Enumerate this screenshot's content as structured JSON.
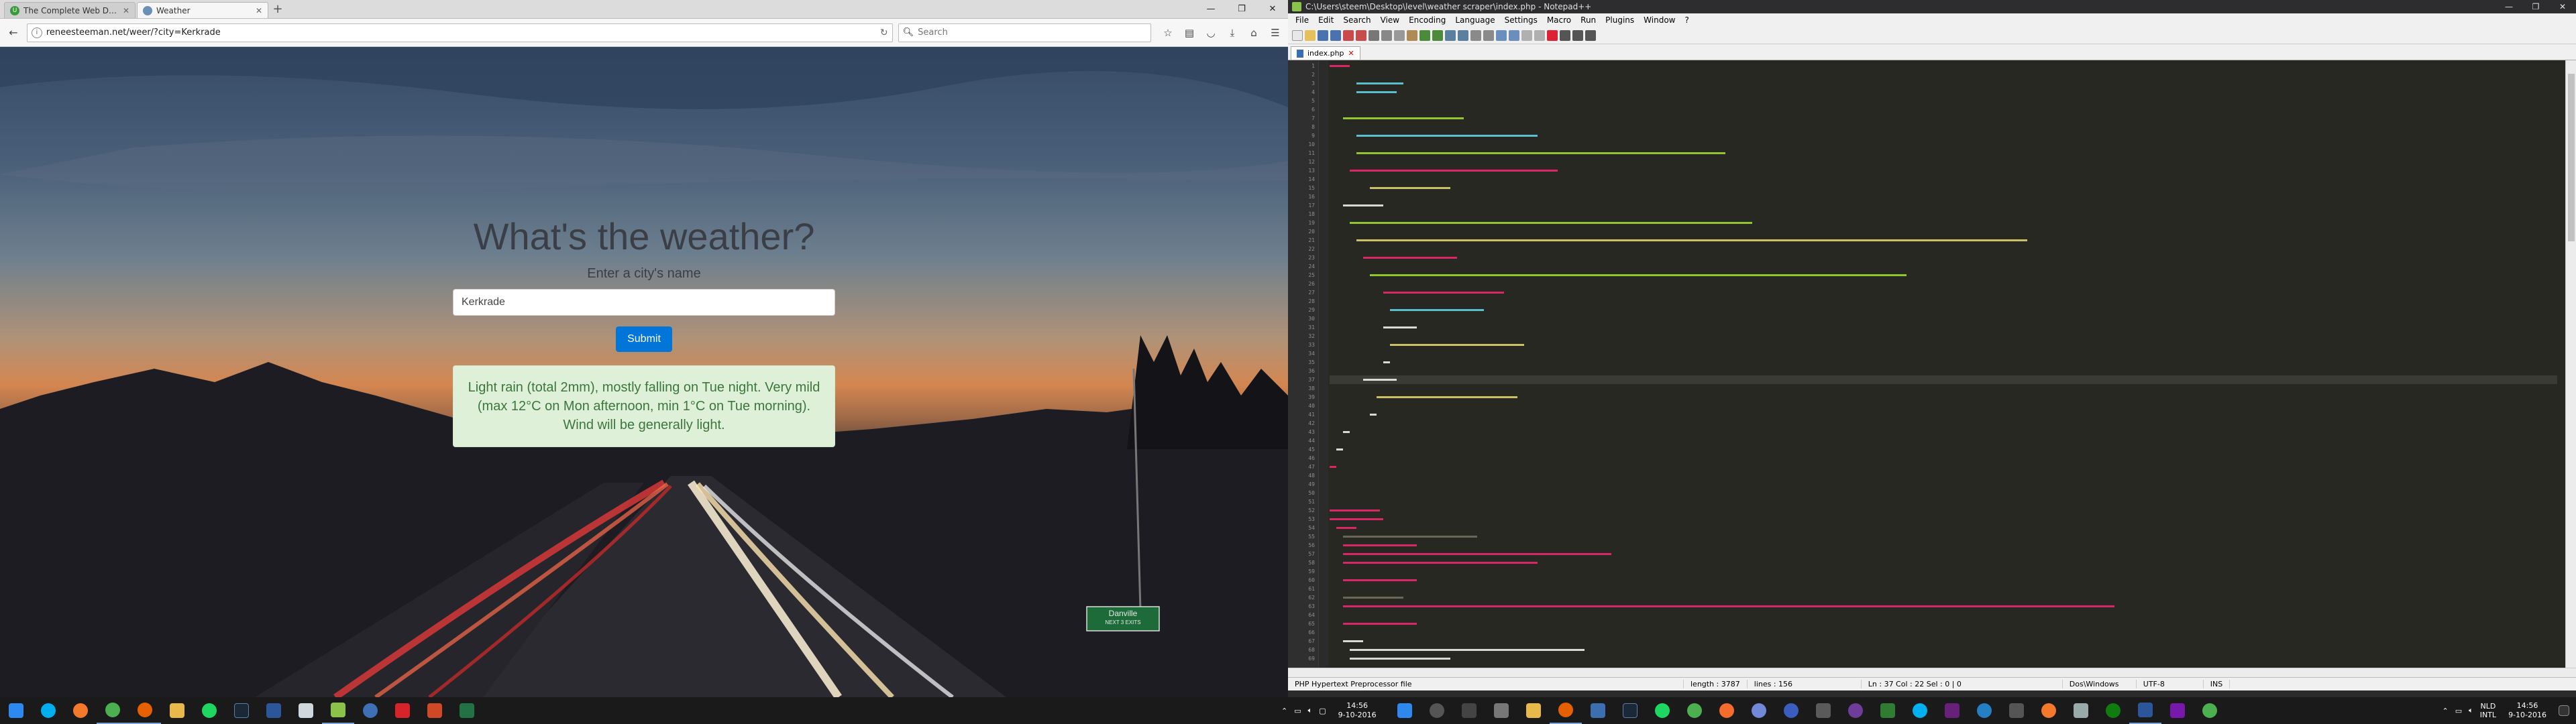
{
  "browser": {
    "tabs": [
      {
        "title": "The Complete Web Devel..."
      },
      {
        "title": "Weather"
      }
    ],
    "url": "reneesteeman.net/weer/?city=Kerkrade",
    "search_placeholder": "Search"
  },
  "page": {
    "title": "What's the weather?",
    "label": "Enter a city's name",
    "input_value": "Kerkrade",
    "submit_label": "Submit",
    "forecast": "Light rain (total 2mm), mostly falling on Tue night. Very mild (max 12°C on Mon afternoon, min 1°C on Tue morning). Wind will be generally light.",
    "road_sign_line1": "Danville",
    "road_sign_line2": "NEXT 3 EXITS"
  },
  "npp": {
    "title": "C:\\Users\\steem\\Desktop\\level\\weather scraper\\index.php - Notepad++",
    "menu": [
      "File",
      "Edit",
      "Search",
      "View",
      "Encoding",
      "Language",
      "Settings",
      "Macro",
      "Run",
      "Plugins",
      "Window",
      "?"
    ],
    "tab": "index.php",
    "status": {
      "type": "PHP Hypertext Preprocessor file",
      "length": "length : 3787",
      "lines": "lines : 156",
      "pos": "Ln : 37   Col : 22   Sel : 0 | 0",
      "eol": "Dos\\Windows",
      "enc": "UTF-8",
      "ins": "INS"
    }
  },
  "taskbar": {
    "lang1": "NLD",
    "lang2": "INTL",
    "time": "14:56",
    "date": "9-10-2016"
  }
}
